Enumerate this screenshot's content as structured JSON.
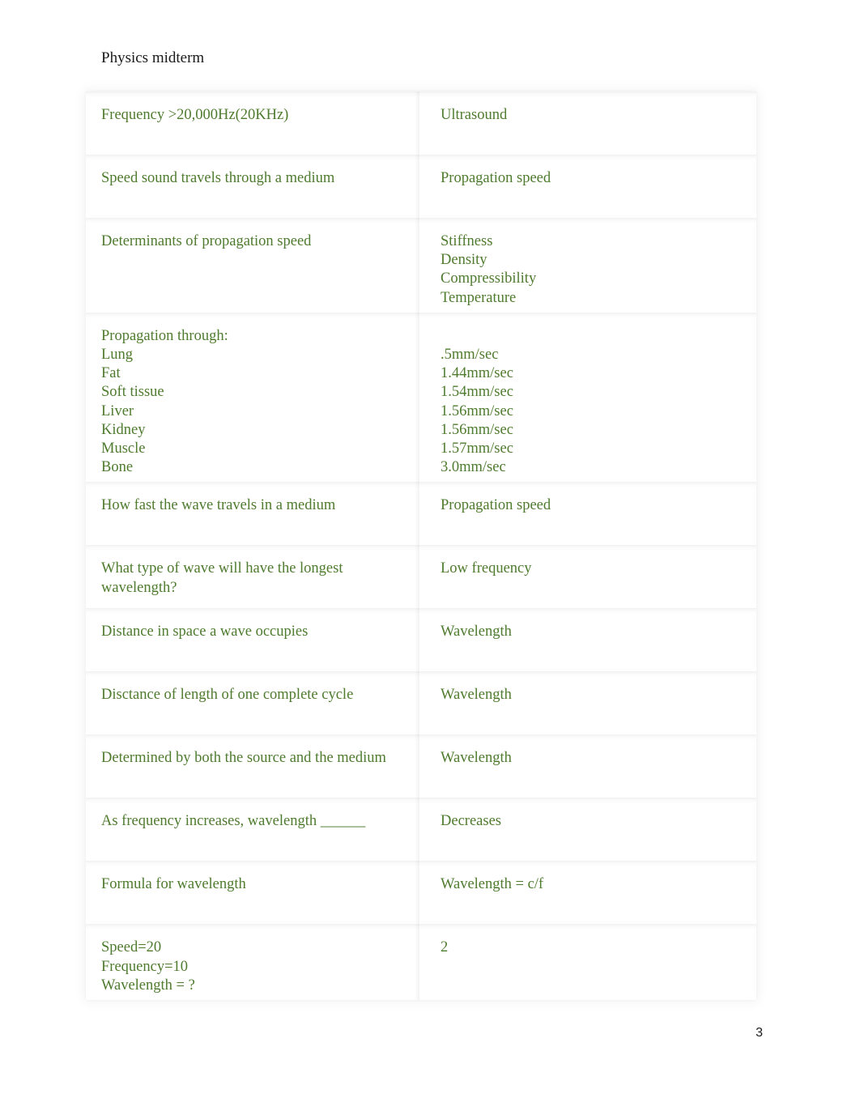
{
  "document": {
    "title": "Physics midterm",
    "page_number": "3",
    "text_color": "#4f7b2e",
    "title_color": "#1a1a1a"
  },
  "table": {
    "rows": [
      {
        "term": "Frequency >20,000Hz(20KHz)",
        "definition": "Ultrasound",
        "tall": true
      },
      {
        "term": "Speed sound travels through a medium",
        "definition": "Propagation speed",
        "tall": true
      },
      {
        "term": "Determinants of propagation speed",
        "definition": "Stiffness\nDensity\nCompressibility\nTemperature",
        "tall": false
      },
      {
        "term": "Propagation through:\nLung\nFat\nSoft tissue\nLiver\nKidney\nMuscle\nBone",
        "definition": "\n.5mm/sec\n1.44mm/sec\n1.54mm/sec\n1.56mm/sec\n1.56mm/sec\n1.57mm/sec\n3.0mm/sec",
        "tall": false
      },
      {
        "term": "How fast the wave travels in a medium",
        "definition": "Propagation speed",
        "tall": true
      },
      {
        "term": "What type of wave will have the longest wavelength?",
        "definition": "Low frequency",
        "tall": true
      },
      {
        "term": "Distance in space a wave occupies",
        "definition": "Wavelength",
        "tall": true
      },
      {
        "term": "Disctance of length of one complete cycle",
        "definition": "Wavelength",
        "tall": true
      },
      {
        "term": "Determined by both the source and the medium",
        "definition": "Wavelength",
        "tall": true
      },
      {
        "term": "As frequency increases, wavelength ______",
        "definition": "Decreases",
        "tall": true
      },
      {
        "term": "Formula for wavelength",
        "definition": "Wavelength = c/f",
        "tall": true
      },
      {
        "term": "Speed=20\nFrequency=10\nWavelength = ?",
        "definition": "2",
        "tall": false
      }
    ]
  }
}
